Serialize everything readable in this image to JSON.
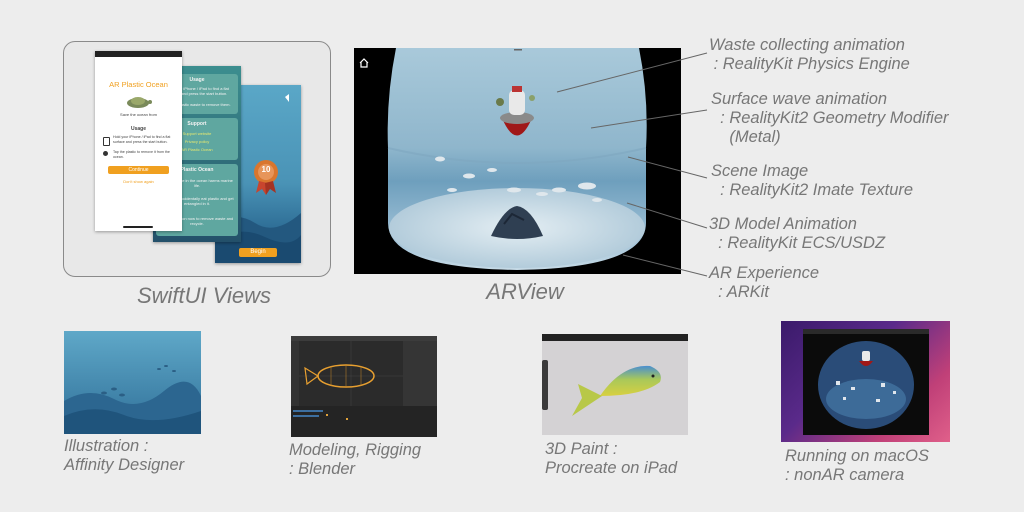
{
  "swiftui": {
    "caption": "SwiftUI Views",
    "screen1": {
      "title": "AR Plastic Ocean",
      "subtitle": "Save the ocean from",
      "usage_heading": "Usage",
      "usage_text1": "Hold your iPhone / iPad to find a flat surface and press the start button.",
      "usage_text2": "Tap the plastic to remove it from the ocean.",
      "continue_label": "Continue",
      "link_label": "Don't show again"
    },
    "screen2": {
      "heading1": "Usage",
      "text1": "Hold your iPhone / iPad to find a flat surface and press the start button.",
      "text2": "Tap the plastic waste to remove them.",
      "heading2": "Support",
      "link1": "Support website",
      "link2": "Privacy policy",
      "link3": "AR Plastic Ocean",
      "heading3": "Plastic Ocean",
      "text3": "Plastic waste in the ocean harms marine life.",
      "text4": "They may accidentally eat plastic and get entangled in it.",
      "text5": "Take an action now to remove waste and recycle."
    },
    "screen3": {
      "badge_number": "10",
      "begin_label": "Begin"
    }
  },
  "arview": {
    "caption": "ARView"
  },
  "annotations": [
    {
      "title": "Waste collecting animation",
      "sub": " : RealityKit Physics Engine"
    },
    {
      "title": "Surface wave animation",
      "sub": "  : RealityKit2 Geometry Modifier\n    (Metal)"
    },
    {
      "title": "Scene Image",
      "sub": "  : RealityKit2 Imate Texture"
    },
    {
      "title": "3D Model Animation",
      "sub": "  : RealityKit ECS/USDZ"
    },
    {
      "title": "AR Experience",
      "sub": "  : ARKit"
    }
  ],
  "bottom": [
    {
      "line1": "Illustration :",
      "line2": "Affinity Designer"
    },
    {
      "line1": "Modeling, Rigging",
      "line2": " : Blender"
    },
    {
      "line1": "3D Paint :",
      "line2": "Procreate on iPad"
    },
    {
      "line1": "Running on macOS",
      "line2": " : nonAR camera"
    }
  ],
  "colors": {
    "background": "#ededed",
    "label_gray": "#777777",
    "accent_orange": "#f0a020",
    "ocean_blue": "#4a93b6"
  }
}
